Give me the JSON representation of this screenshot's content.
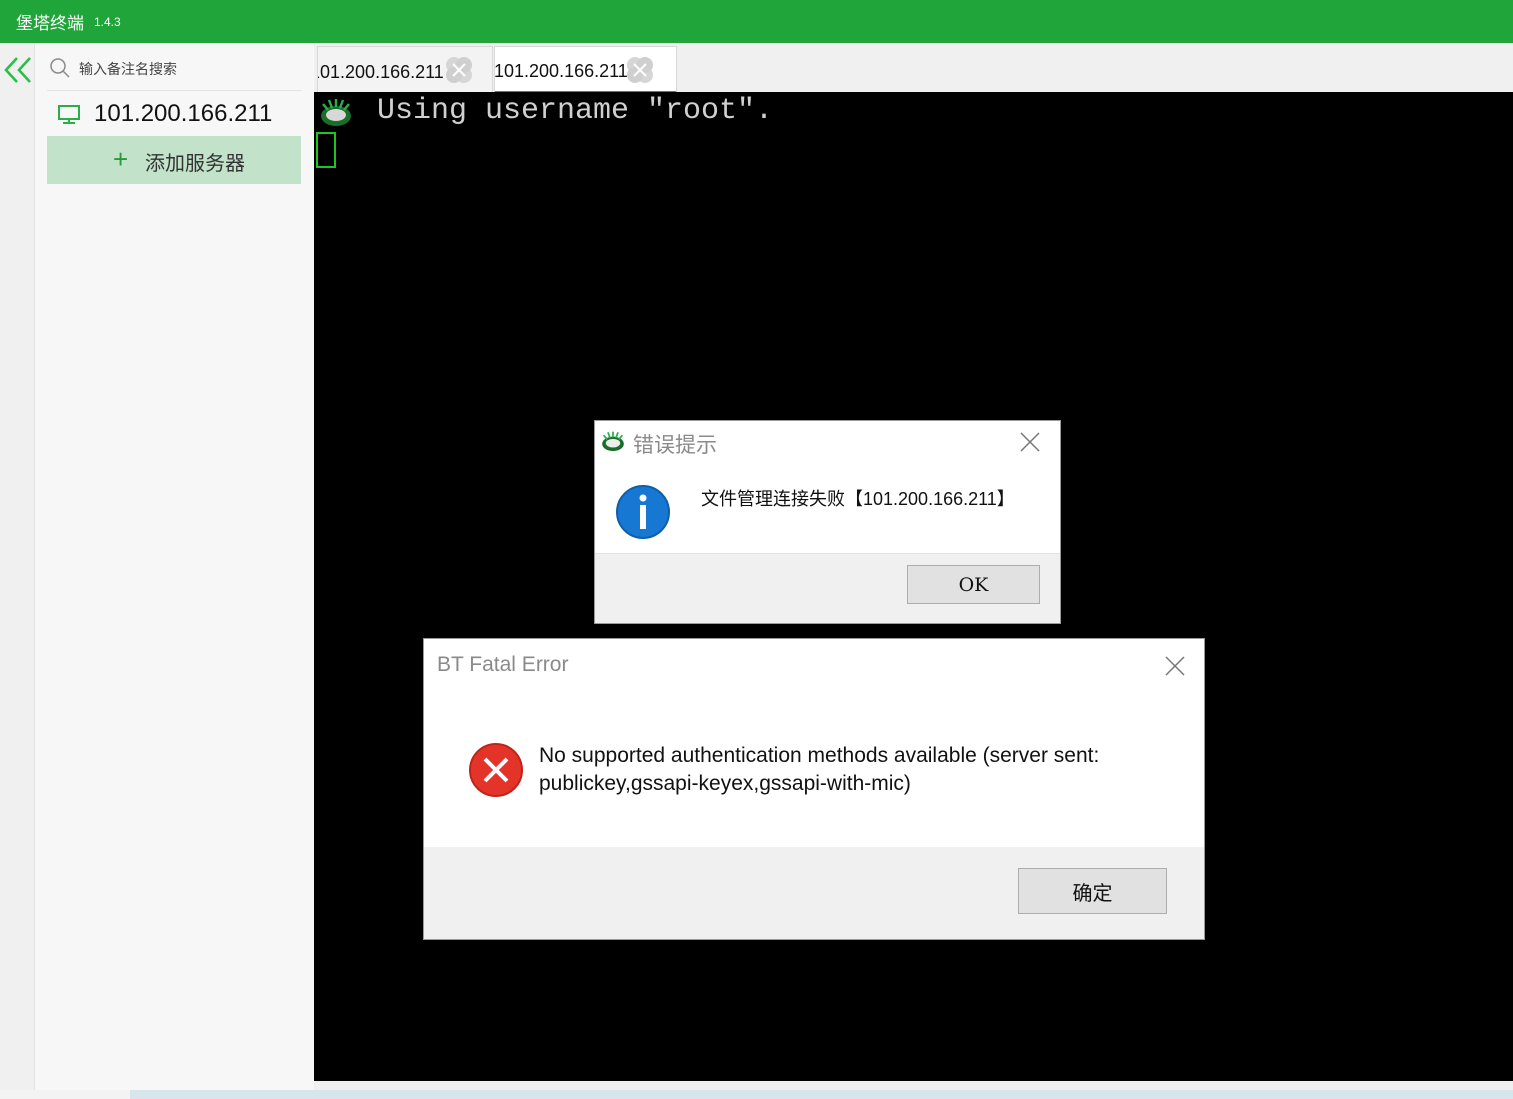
{
  "window": {
    "title": "堡塔终端",
    "version": "1.4.3",
    "accent_color": "#20a53a"
  },
  "sidebar": {
    "collapse_icon": "double-chevron-left-icon",
    "search": {
      "placeholder": "输入备注名搜索",
      "value": ""
    },
    "servers": [
      {
        "label": "101.200.166.211",
        "icon": "monitor-icon"
      }
    ],
    "add_server_label": "添加服务器"
  },
  "tabs": [
    {
      "label": "101.200.166.211",
      "active": false
    },
    {
      "label": "101.200.166.211",
      "active": true
    }
  ],
  "terminal": {
    "lines": [
      "Using username \"root\"."
    ],
    "cursor_color": "#1ec51e"
  },
  "dialogs": {
    "file_manager_error": {
      "title": "错误提示",
      "message": "文件管理连接失败【101.200.166.211】",
      "ok_label": "OK",
      "icon": "info-icon"
    },
    "fatal_error": {
      "title": "BT Fatal Error",
      "message": "No supported authentication methods available (server sent: publickey,gssapi-keyex,gssapi-with-mic)",
      "confirm_label": "确定",
      "icon": "error-icon",
      "icon_color": "#e4342a"
    }
  }
}
